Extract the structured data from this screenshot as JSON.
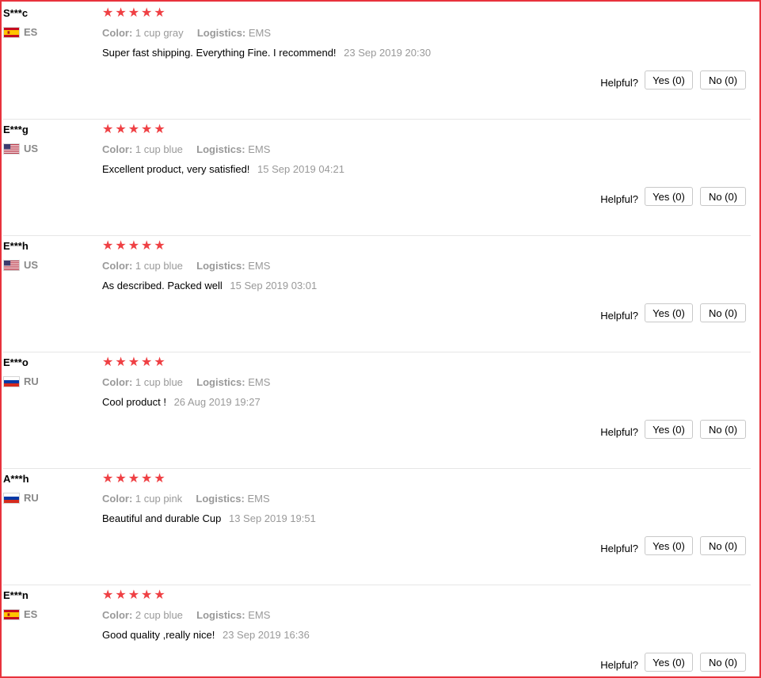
{
  "colors": {
    "star": "#ef4044",
    "frame": "#e8323c",
    "muted_text": "#999999"
  },
  "helpful_label": "Helpful?",
  "color_label": "Color:",
  "logistics_label": "Logistics:",
  "reviews": [
    {
      "user": "S***c",
      "country": "ES",
      "flag_icon": "spain-flag-icon",
      "rating": 5,
      "color": "1 cup gray",
      "logistics": "EMS",
      "text": "Super fast shipping. Everything Fine. I recommend!",
      "date": "23 Sep 2019 20:30",
      "yes": "Yes (0)",
      "no": "No (0)"
    },
    {
      "user": "E***g",
      "country": "US",
      "flag_icon": "us-flag-icon",
      "rating": 5,
      "color": "1 cup blue",
      "logistics": "EMS",
      "text": "Excellent product, very satisfied!",
      "date": "15 Sep 2019 04:21",
      "yes": "Yes (0)",
      "no": "No (0)"
    },
    {
      "user": "E***h",
      "country": "US",
      "flag_icon": "us-flag-icon",
      "rating": 5,
      "color": "1 cup blue",
      "logistics": "EMS",
      "text": "As described. Packed well",
      "date": "15 Sep 2019 03:01",
      "yes": "Yes (0)",
      "no": "No (0)"
    },
    {
      "user": "E***o",
      "country": "RU",
      "flag_icon": "russia-flag-icon",
      "rating": 5,
      "color": "1 cup blue",
      "logistics": "EMS",
      "text": "Cool product !",
      "date": "26 Aug 2019 19:27",
      "yes": "Yes (0)",
      "no": "No (0)"
    },
    {
      "user": "A***h",
      "country": "RU",
      "flag_icon": "russia-flag-icon",
      "rating": 5,
      "color": "1 cup pink",
      "logistics": "EMS",
      "text": "Beautiful and durable Cup",
      "date": "13 Sep 2019 19:51",
      "yes": "Yes (0)",
      "no": "No (0)"
    },
    {
      "user": "E***n",
      "country": "ES",
      "flag_icon": "spain-flag-icon",
      "rating": 5,
      "color": "2 cup blue",
      "logistics": "EMS",
      "text": "Good quality ,really nice!",
      "date": "23 Sep 2019 16:36",
      "yes": "Yes (0)",
      "no": "No (0)"
    }
  ]
}
